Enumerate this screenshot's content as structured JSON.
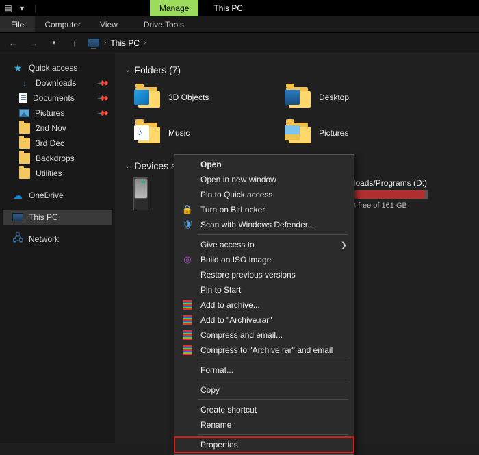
{
  "titlebar": {
    "manage": "Manage",
    "title": "This PC"
  },
  "ribbon": {
    "file": "File",
    "computer": "Computer",
    "view": "View",
    "drive_tools": "Drive Tools"
  },
  "breadcrumb": {
    "location": "This PC"
  },
  "sidebar": {
    "quick_access": "Quick access",
    "items": [
      {
        "label": "Downloads"
      },
      {
        "label": "Documents"
      },
      {
        "label": "Pictures"
      },
      {
        "label": "2nd Nov"
      },
      {
        "label": "3rd Dec"
      },
      {
        "label": "Backdrops"
      },
      {
        "label": "Utilities"
      }
    ],
    "onedrive": "OneDrive",
    "this_pc": "This PC",
    "network": "Network"
  },
  "groups": {
    "folders_hdr": "Folders (7)",
    "folders": [
      {
        "label": "3D Objects"
      },
      {
        "label": "Desktop"
      },
      {
        "label": "Music"
      },
      {
        "label": "Pictures"
      }
    ],
    "drives_hdr": "Devices and drives (2)",
    "drive_d": {
      "label": "Downloads/Programs (D:)",
      "sub": "4.9 GB free of 161 GB"
    }
  },
  "context_menu": {
    "open": "Open",
    "open_new": "Open in new window",
    "pin_quick": "Pin to Quick access",
    "bitlocker": "Turn on BitLocker",
    "defender": "Scan with Windows Defender...",
    "give_access": "Give access to",
    "build_iso": "Build an ISO image",
    "restore": "Restore previous versions",
    "pin_start": "Pin to Start",
    "add_archive": "Add to archive...",
    "add_rar": "Add to \"Archive.rar\"",
    "compress_email": "Compress and email...",
    "compress_rar_email": "Compress to \"Archive.rar\" and email",
    "format": "Format...",
    "copy": "Copy",
    "shortcut": "Create shortcut",
    "rename": "Rename",
    "properties": "Properties"
  }
}
